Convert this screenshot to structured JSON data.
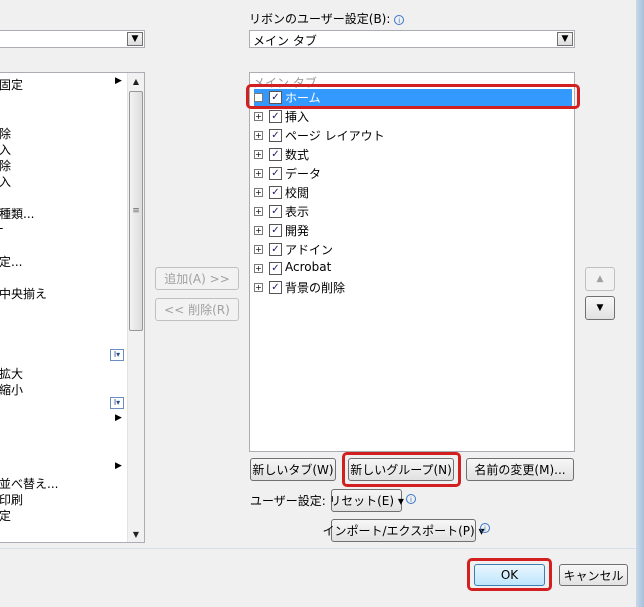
{
  "ribbon_settings": {
    "label": "リボンのユーザー設定(B):",
    "dropdown_value": "メイン タブ"
  },
  "left_list": {
    "items": [
      "固定",
      "除",
      "入",
      "除",
      "入",
      "種類...",
      "-",
      "定...",
      "中央揃え",
      "拡大",
      "縮小",
      "並べ替え...",
      "印刷",
      "定"
    ]
  },
  "middle_buttons": {
    "add": "追加(A) >>",
    "remove": "<< 削除(R)"
  },
  "main_tabs_tree": {
    "header": "メイン タブ",
    "items": [
      {
        "label": "ホーム",
        "checked": true,
        "selected": true
      },
      {
        "label": "挿入",
        "checked": true
      },
      {
        "label": "ページ レイアウト",
        "checked": true
      },
      {
        "label": "数式",
        "checked": true
      },
      {
        "label": "データ",
        "checked": true
      },
      {
        "label": "校閲",
        "checked": true
      },
      {
        "label": "表示",
        "checked": true
      },
      {
        "label": "開発",
        "checked": true
      },
      {
        "label": "アドイン",
        "checked": true
      },
      {
        "label": "Acrobat",
        "checked": true
      },
      {
        "label": "背景の削除",
        "checked": true
      }
    ]
  },
  "bottom_buttons": {
    "new_tab": "新しいタブ(W)",
    "new_group": "新しいグループ(N)",
    "rename": "名前の変更(M)..."
  },
  "user_settings": {
    "label": "ユーザー設定:",
    "reset": "リセット(E) ▾",
    "import_export": "インポート/エクスポート(P) ▾"
  },
  "dialog_buttons": {
    "ok": "OK",
    "cancel": "キャンセル"
  },
  "colors": {
    "selection": "#3399ff",
    "highlight_ring": "#d21f1f"
  }
}
